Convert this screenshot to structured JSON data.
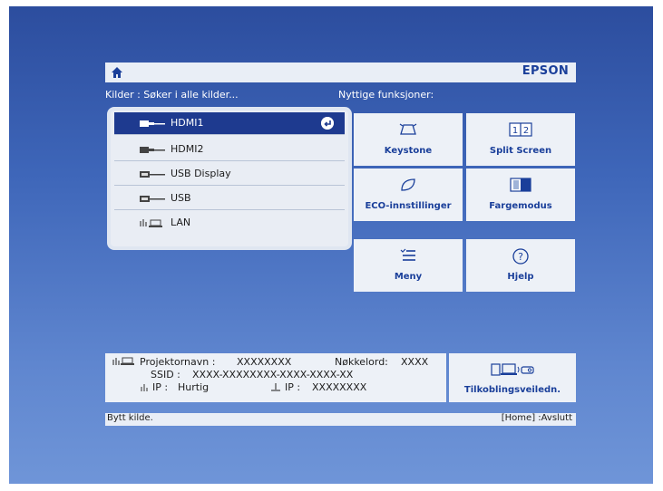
{
  "header": {
    "brand": "EPSON",
    "home_icon": "home-icon"
  },
  "sources": {
    "heading": "Kilder : Søker i alle kilder...",
    "items": [
      {
        "label": "HDMI1",
        "icon": "hdmi-connector-icon",
        "selected": true
      },
      {
        "label": "HDMI2",
        "icon": "hdmi-connector-icon",
        "selected": false
      },
      {
        "label": "USB Display",
        "icon": "usb-cable-icon",
        "selected": false
      },
      {
        "label": "USB",
        "icon": "usb-cable-icon",
        "selected": false
      },
      {
        "label": "LAN",
        "icon": "network-icon",
        "selected": false
      }
    ]
  },
  "functions": {
    "heading": "Nyttige funksjoner:",
    "tiles": [
      {
        "label": "Keystone",
        "icon": "keystone-icon"
      },
      {
        "label": "Split Screen",
        "icon": "split-screen-icon",
        "icon_text_left": "1",
        "icon_text_right": "2"
      },
      {
        "label": "ECO-innstillinger",
        "icon": "eco-leaf-icon"
      },
      {
        "label": "Fargemodus",
        "icon": "color-mode-icon"
      },
      {
        "label": "Meny",
        "icon": "menu-list-icon"
      },
      {
        "label": "Hjelp",
        "icon": "help-icon",
        "icon_text": "?"
      }
    ]
  },
  "info": {
    "projector_name_label": "Projektornavn :",
    "projector_name": "XXXXXXXX",
    "keyword_label": "Nøkkelord:",
    "keyword": "XXXX",
    "ssid_label": "SSID :",
    "ssid": "XXXX-XXXXXXXX-XXXX-XXXX-XX",
    "ip_label": "IP :",
    "ip_mode": "Hurtig",
    "lan_ip_label": "IP :",
    "lan_ip": "XXXXXXXX"
  },
  "connection_guide": {
    "label": "Tilkoblingsveiledn.",
    "icon": "connection-guide-icon"
  },
  "footer": {
    "left": "Bytt kilde.",
    "right": "[Home] :Avslutt"
  }
}
